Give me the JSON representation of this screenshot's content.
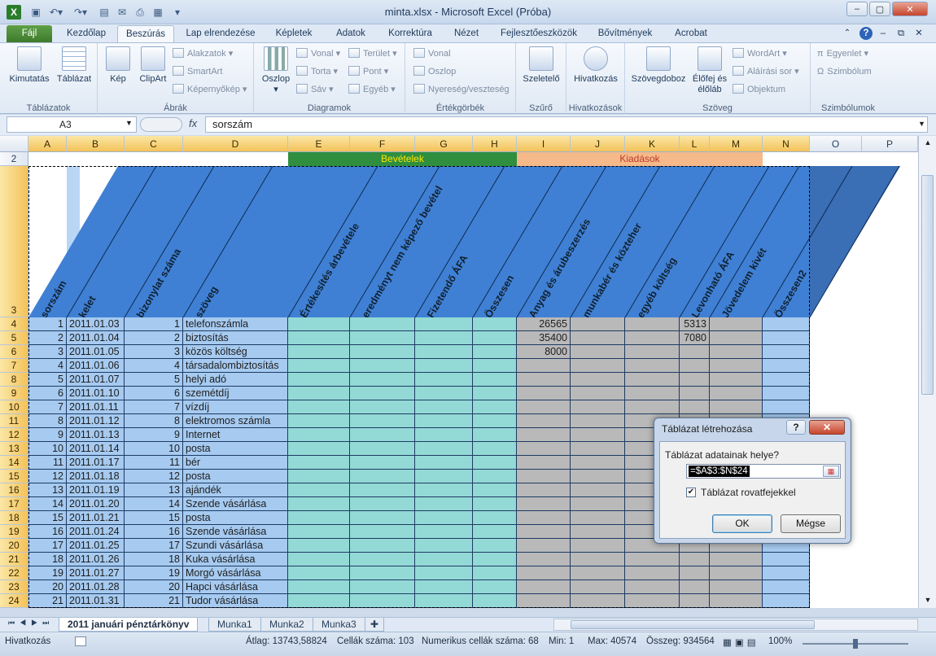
{
  "window": {
    "title": "minta.xlsx - Microsoft Excel (Próba)",
    "controls": [
      "–",
      "▢",
      "✕"
    ]
  },
  "tabs": [
    "Fájl",
    "Kezdőlap",
    "Beszúrás",
    "Lap elrendezése",
    "Képletek",
    "Adatok",
    "Korrektúra",
    "Nézet",
    "Fejlesztőeszközök",
    "Bővítmények",
    "Acrobat"
  ],
  "active_tab": "Beszúrás",
  "ribbon": {
    "groups": [
      {
        "label": "Táblázatok",
        "big": [
          "Kimutatás",
          "Táblázat"
        ],
        "small": []
      },
      {
        "label": "Ábrák",
        "big": [
          "Kép",
          "ClipArt"
        ],
        "small": [
          "Alakzatok",
          "SmartArt",
          "Képernyőkép"
        ]
      },
      {
        "label": "Diagramok",
        "big": [
          "Oszlop"
        ],
        "small": [
          "Vonal",
          "Torta",
          "Sáv",
          "Terület",
          "Pont",
          "Egyéb"
        ]
      },
      {
        "label": "Értékgörbék",
        "big": [],
        "small": [
          "Vonal",
          "Oszlop",
          "Nyereség/veszteség"
        ]
      },
      {
        "label": "Szűrő",
        "big": [
          "Szeletelő"
        ],
        "small": []
      },
      {
        "label": "Hivatkozások",
        "big": [
          "Hivatkozás"
        ],
        "small": []
      },
      {
        "label": "Szöveg",
        "big": [
          "Szövegdoboz",
          "Élőfej és élőláb"
        ],
        "small": [
          "WordArt",
          "Aláírási sor",
          "Objektum"
        ]
      },
      {
        "label": "Szimbólumok",
        "big": [],
        "small": [
          "Egyenlet",
          "Szimbólum"
        ]
      }
    ]
  },
  "formula_bar": {
    "name_box": "A3",
    "fx": "fx",
    "content": "sorszám"
  },
  "columns": [
    "A",
    "B",
    "C",
    "D",
    "E",
    "F",
    "G",
    "H",
    "I",
    "J",
    "K",
    "L",
    "M",
    "N",
    "O",
    "P"
  ],
  "row2": {
    "income": "Bevételek",
    "expense": "Kiadások"
  },
  "header_row": [
    "sorszám",
    "kelet",
    "bizonylat száma",
    "szöveg",
    "Értékesítés árbevétele",
    "eredményt nem képező bevétel",
    "Fizetendő ÁFA",
    "Összesen",
    "Anyag és árubeszerzés",
    "munkabér és közteher",
    "egyéb költség",
    "Levonható ÁFA",
    "Jövedelem kivét",
    "Összesen2"
  ],
  "rows": [
    {
      "n": "4",
      "a": "1",
      "b": "2011.01.03",
      "c": "1",
      "d": "telefonszámla",
      "i": "26565",
      "l": "5313"
    },
    {
      "n": "5",
      "a": "2",
      "b": "2011.01.04",
      "c": "2",
      "d": "biztosítás",
      "i": "35400",
      "l": "7080"
    },
    {
      "n": "6",
      "a": "3",
      "b": "2011.01.05",
      "c": "3",
      "d": "közös költség",
      "i": "8000",
      "l": ""
    },
    {
      "n": "7",
      "a": "4",
      "b": "2011.01.06",
      "c": "4",
      "d": "társadalombiztosítás",
      "i": "",
      "l": ""
    },
    {
      "n": "8",
      "a": "5",
      "b": "2011.01.07",
      "c": "5",
      "d": "helyi adó",
      "i": "",
      "l": ""
    },
    {
      "n": "9",
      "a": "6",
      "b": "2011.01.10",
      "c": "6",
      "d": "szemétdíj",
      "i": "",
      "l": ""
    },
    {
      "n": "10",
      "a": "7",
      "b": "2011.01.11",
      "c": "7",
      "d": "vízdíj",
      "i": "",
      "l": ""
    },
    {
      "n": "11",
      "a": "8",
      "b": "2011.01.12",
      "c": "8",
      "d": "elektromos számla",
      "i": "",
      "l": ""
    },
    {
      "n": "12",
      "a": "9",
      "b": "2011.01.13",
      "c": "9",
      "d": "Internet",
      "i": "",
      "l": ""
    },
    {
      "n": "13",
      "a": "10",
      "b": "2011.01.14",
      "c": "10",
      "d": "posta",
      "i": "",
      "l": ""
    },
    {
      "n": "14",
      "a": "11",
      "b": "2011.01.17",
      "c": "11",
      "d": "bér",
      "i": "",
      "l": ""
    },
    {
      "n": "15",
      "a": "12",
      "b": "2011.01.18",
      "c": "12",
      "d": "posta",
      "i": "",
      "l": ""
    },
    {
      "n": "16",
      "a": "13",
      "b": "2011.01.19",
      "c": "13",
      "d": "ajándék",
      "i": "",
      "l": ""
    },
    {
      "n": "17",
      "a": "14",
      "b": "2011.01.20",
      "c": "14",
      "d": "Szende vásárlása",
      "i": "",
      "l": ""
    },
    {
      "n": "18",
      "a": "15",
      "b": "2011.01.21",
      "c": "15",
      "d": "posta",
      "i": "",
      "l": ""
    },
    {
      "n": "19",
      "a": "16",
      "b": "2011.01.24",
      "c": "16",
      "d": "Szende vásárlása",
      "i": "",
      "l": ""
    },
    {
      "n": "20",
      "a": "17",
      "b": "2011.01.25",
      "c": "17",
      "d": "Szundi vásárlása",
      "i": "",
      "l": ""
    },
    {
      "n": "21",
      "a": "18",
      "b": "2011.01.26",
      "c": "18",
      "d": "Kuka vásárlása",
      "i": "",
      "l": ""
    },
    {
      "n": "22",
      "a": "19",
      "b": "2011.01.27",
      "c": "19",
      "d": "Morgó vásárlása",
      "i": "",
      "l": ""
    },
    {
      "n": "23",
      "a": "20",
      "b": "2011.01.28",
      "c": "20",
      "d": "Hapci vásárlása",
      "i": "",
      "l": ""
    },
    {
      "n": "24",
      "a": "21",
      "b": "2011.01.31",
      "c": "21",
      "d": "Tudor vásárlása",
      "i": "",
      "l": ""
    }
  ],
  "dialog": {
    "title": "Táblázat létrehozása",
    "help": "?",
    "close": "✕",
    "prompt": "Táblázat adatainak helye?",
    "range": "=$A$3:$N$24",
    "checkbox_label": "Táblázat rovatfejekkel",
    "checkbox_checked": true,
    "ok": "OK",
    "cancel": "Mégse"
  },
  "sheet_tabs": [
    "2011 januári pénztárkönyv",
    "Munka1",
    "Munka2",
    "Munka3"
  ],
  "active_sheet": "2011 januári pénztárkönyv",
  "status": {
    "mode": "Hivatkozás",
    "avg": "Átlag: 13743,58824",
    "count": "Cellák száma: 103",
    "numcount": "Numerikus cellák száma: 68",
    "min": "Min: 1",
    "max": "Max: 40574",
    "sum": "Összeg: 934564",
    "zoom": "100%"
  },
  "colors": {
    "header_blue": "#3f80d4",
    "col_a_d_fill": "#a6caf0",
    "income_fill": "#93dad6",
    "expense_fill": "#b9b9b9",
    "n_fill": "#a6caf0",
    "income_banner": "#2f8f3f",
    "expense_banner": "#f5b98a"
  }
}
